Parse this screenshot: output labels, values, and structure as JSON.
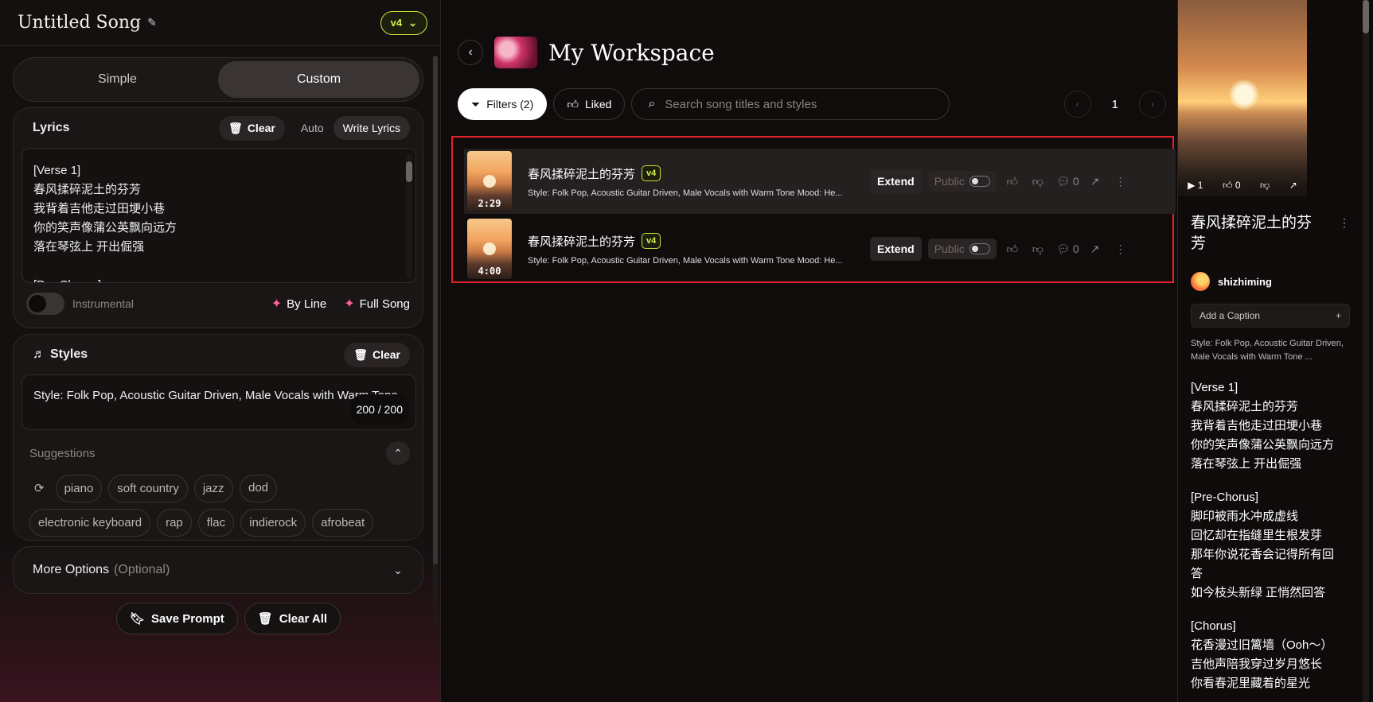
{
  "left": {
    "song_title": "Untitled Song",
    "version": "v4",
    "tabs": [
      "Simple",
      "Custom"
    ],
    "lyrics": {
      "title": "Lyrics",
      "clear": "Clear",
      "auto": "Auto",
      "write": "Write Lyrics",
      "lines": [
        "[Verse 1]",
        "春风揉碎泥土的芬芳",
        "我背着吉他走过田埂小巷",
        "你的笑声像蒲公英飘向远方",
        "落在琴弦上 开出倔强",
        "",
        "[Pre-Chorus]"
      ],
      "instrumental": "Instrumental",
      "by_line": "By Line",
      "full_song": "Full Song"
    },
    "styles": {
      "title": "Styles",
      "clear": "Clear",
      "text": "Style: Folk Pop, Acoustic Guitar Driven, Male Vocals with Warm Tone",
      "counter": "200 / 200",
      "suggestions_label": "Suggestions",
      "chips_row1": [
        "piano",
        "soft country",
        "jazz",
        "pop"
      ],
      "chips_row2": [
        "electronic keyboard",
        "rap",
        "flac",
        "indierock",
        "afrobeat"
      ]
    },
    "more_options": "More Options",
    "optional": "(Optional)",
    "save_prompt": "Save Prompt",
    "clear_all": "Clear All"
  },
  "center": {
    "title": "My Workspace",
    "filters": "Filters (2)",
    "liked": "Liked",
    "search_placeholder": "Search song titles and styles",
    "page": "1",
    "songs": [
      {
        "title": "春风揉碎泥土的芬芳",
        "version": "v4",
        "duration": "2:29",
        "style": "Style: Folk Pop, Acoustic Guitar Driven, Male Vocals with Warm Tone Mood: He...",
        "extend": "Extend",
        "public": "Public",
        "comments": "0"
      },
      {
        "title": "春风揉碎泥土的芬芳",
        "version": "v4",
        "duration": "4:00",
        "style": "Style: Folk Pop, Acoustic Guitar Driven, Male Vocals with Warm Tone Mood: He...",
        "extend": "Extend",
        "public": "Public",
        "comments": "0"
      }
    ]
  },
  "right": {
    "plays": "1",
    "likes": "0",
    "title": "春风揉碎泥土的芬芳",
    "user": "shizhiming",
    "caption": "Add a Caption",
    "style": "Style: Folk Pop, Acoustic Guitar Driven, Male Vocals with Warm Tone ...",
    "lyrics": [
      "[Verse 1]",
      "春风揉碎泥土的芬芳",
      "我背着吉他走过田埂小巷",
      "你的笑声像蒲公英飘向远方",
      "落在琴弦上 开出倔强",
      "",
      "[Pre-Chorus]",
      "脚印被雨水冲成虚线",
      "回忆却在指缝里生根发芽",
      "那年你说花香会记得所有回",
      "答",
      "如今枝头新绿 正悄然回答",
      "",
      "[Chorus]",
      "花香漫过旧篱墙（Ooh～）",
      "吉他声陪我穿过岁月悠长",
      "你看春泥里藏着的星光"
    ]
  }
}
